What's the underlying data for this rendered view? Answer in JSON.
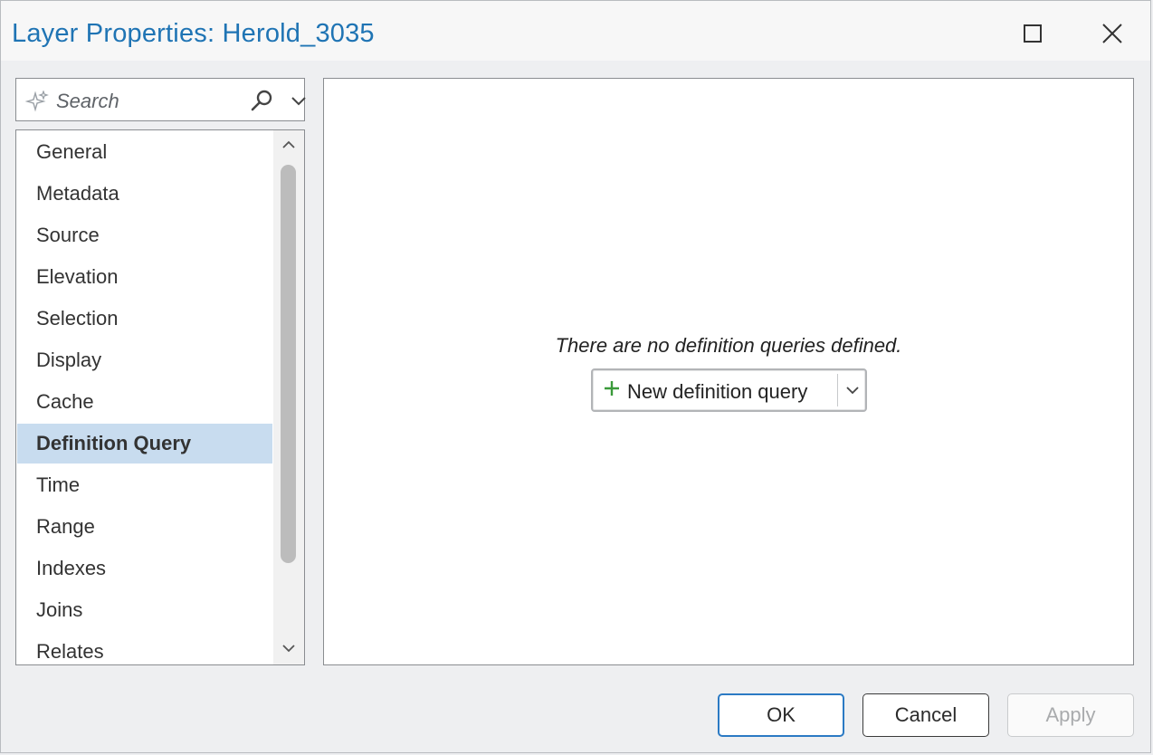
{
  "dialog": {
    "title": "Layer Properties: Herold_3035",
    "maximize_icon": "maximize-icon",
    "close_icon": "close-icon"
  },
  "search": {
    "placeholder": "Search",
    "icons": [
      "sparkle-icon",
      "search-icon",
      "chevron-down-icon"
    ]
  },
  "sidebar": {
    "items": [
      {
        "label": "General"
      },
      {
        "label": "Metadata"
      },
      {
        "label": "Source"
      },
      {
        "label": "Elevation"
      },
      {
        "label": "Selection"
      },
      {
        "label": "Display"
      },
      {
        "label": "Cache"
      },
      {
        "label": "Definition Query",
        "selected": true
      },
      {
        "label": "Time"
      },
      {
        "label": "Range"
      },
      {
        "label": "Indexes"
      },
      {
        "label": "Joins"
      },
      {
        "label": "Relates"
      }
    ]
  },
  "content": {
    "empty_message": "There are no definition queries defined.",
    "new_query_label": "New definition query"
  },
  "footer": {
    "ok_label": "OK",
    "cancel_label": "Cancel",
    "apply_label": "Apply",
    "apply_enabled": false
  },
  "colors": {
    "accent": "#1f74b4",
    "selection": "#c8dcef",
    "plus_green": "#3a9a3a"
  }
}
